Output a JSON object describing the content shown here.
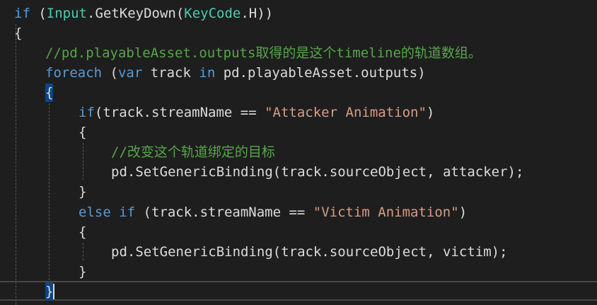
{
  "code": {
    "l1": {
      "kw": "if",
      "sp": " (",
      "type1": "Input",
      "dot": ".",
      "method": "GetKeyDown(",
      "type2": "KeyCode",
      "end": ".H))"
    },
    "l2": {
      "brace": "{"
    },
    "l3": {
      "comment": "//pd.playableAsset.outputs取得的是这个timeline的轨道数组。"
    },
    "l4": {
      "kw1": "foreach",
      "sp1": " (",
      "kw2": "var",
      "mid": " track ",
      "kw3": "in",
      "end": " pd.playableAsset.outputs)"
    },
    "l5": {
      "brace": "{"
    },
    "l6": {
      "kw": "if",
      "mid": "(track.streamName == ",
      "str": "\"Attacker Animation\"",
      "end": ")"
    },
    "l7": {
      "brace": "{"
    },
    "l8": {
      "comment": "//改变这个轨道绑定的目标"
    },
    "l9": {
      "text": "pd.SetGenericBinding(track.sourceObject, attacker);"
    },
    "l10": {
      "brace": "}"
    },
    "l11": {
      "kw1": "else",
      "sp": " ",
      "kw2": "if",
      "mid": " (track.streamName == ",
      "str": "\"Victim Animation\"",
      "end": ")"
    },
    "l12": {
      "brace": "{"
    },
    "l13": {
      "text": "pd.SetGenericBinding(track.sourceObject, victim);"
    },
    "l14": {
      "brace": "}"
    },
    "l15": {
      "brace": "}"
    }
  },
  "colors": {
    "background": "#1e1e1e",
    "keyword": "#569cd6",
    "type": "#4ec9b0",
    "string": "#d69d85",
    "comment": "#57a64a",
    "text": "#dcdcdc"
  }
}
